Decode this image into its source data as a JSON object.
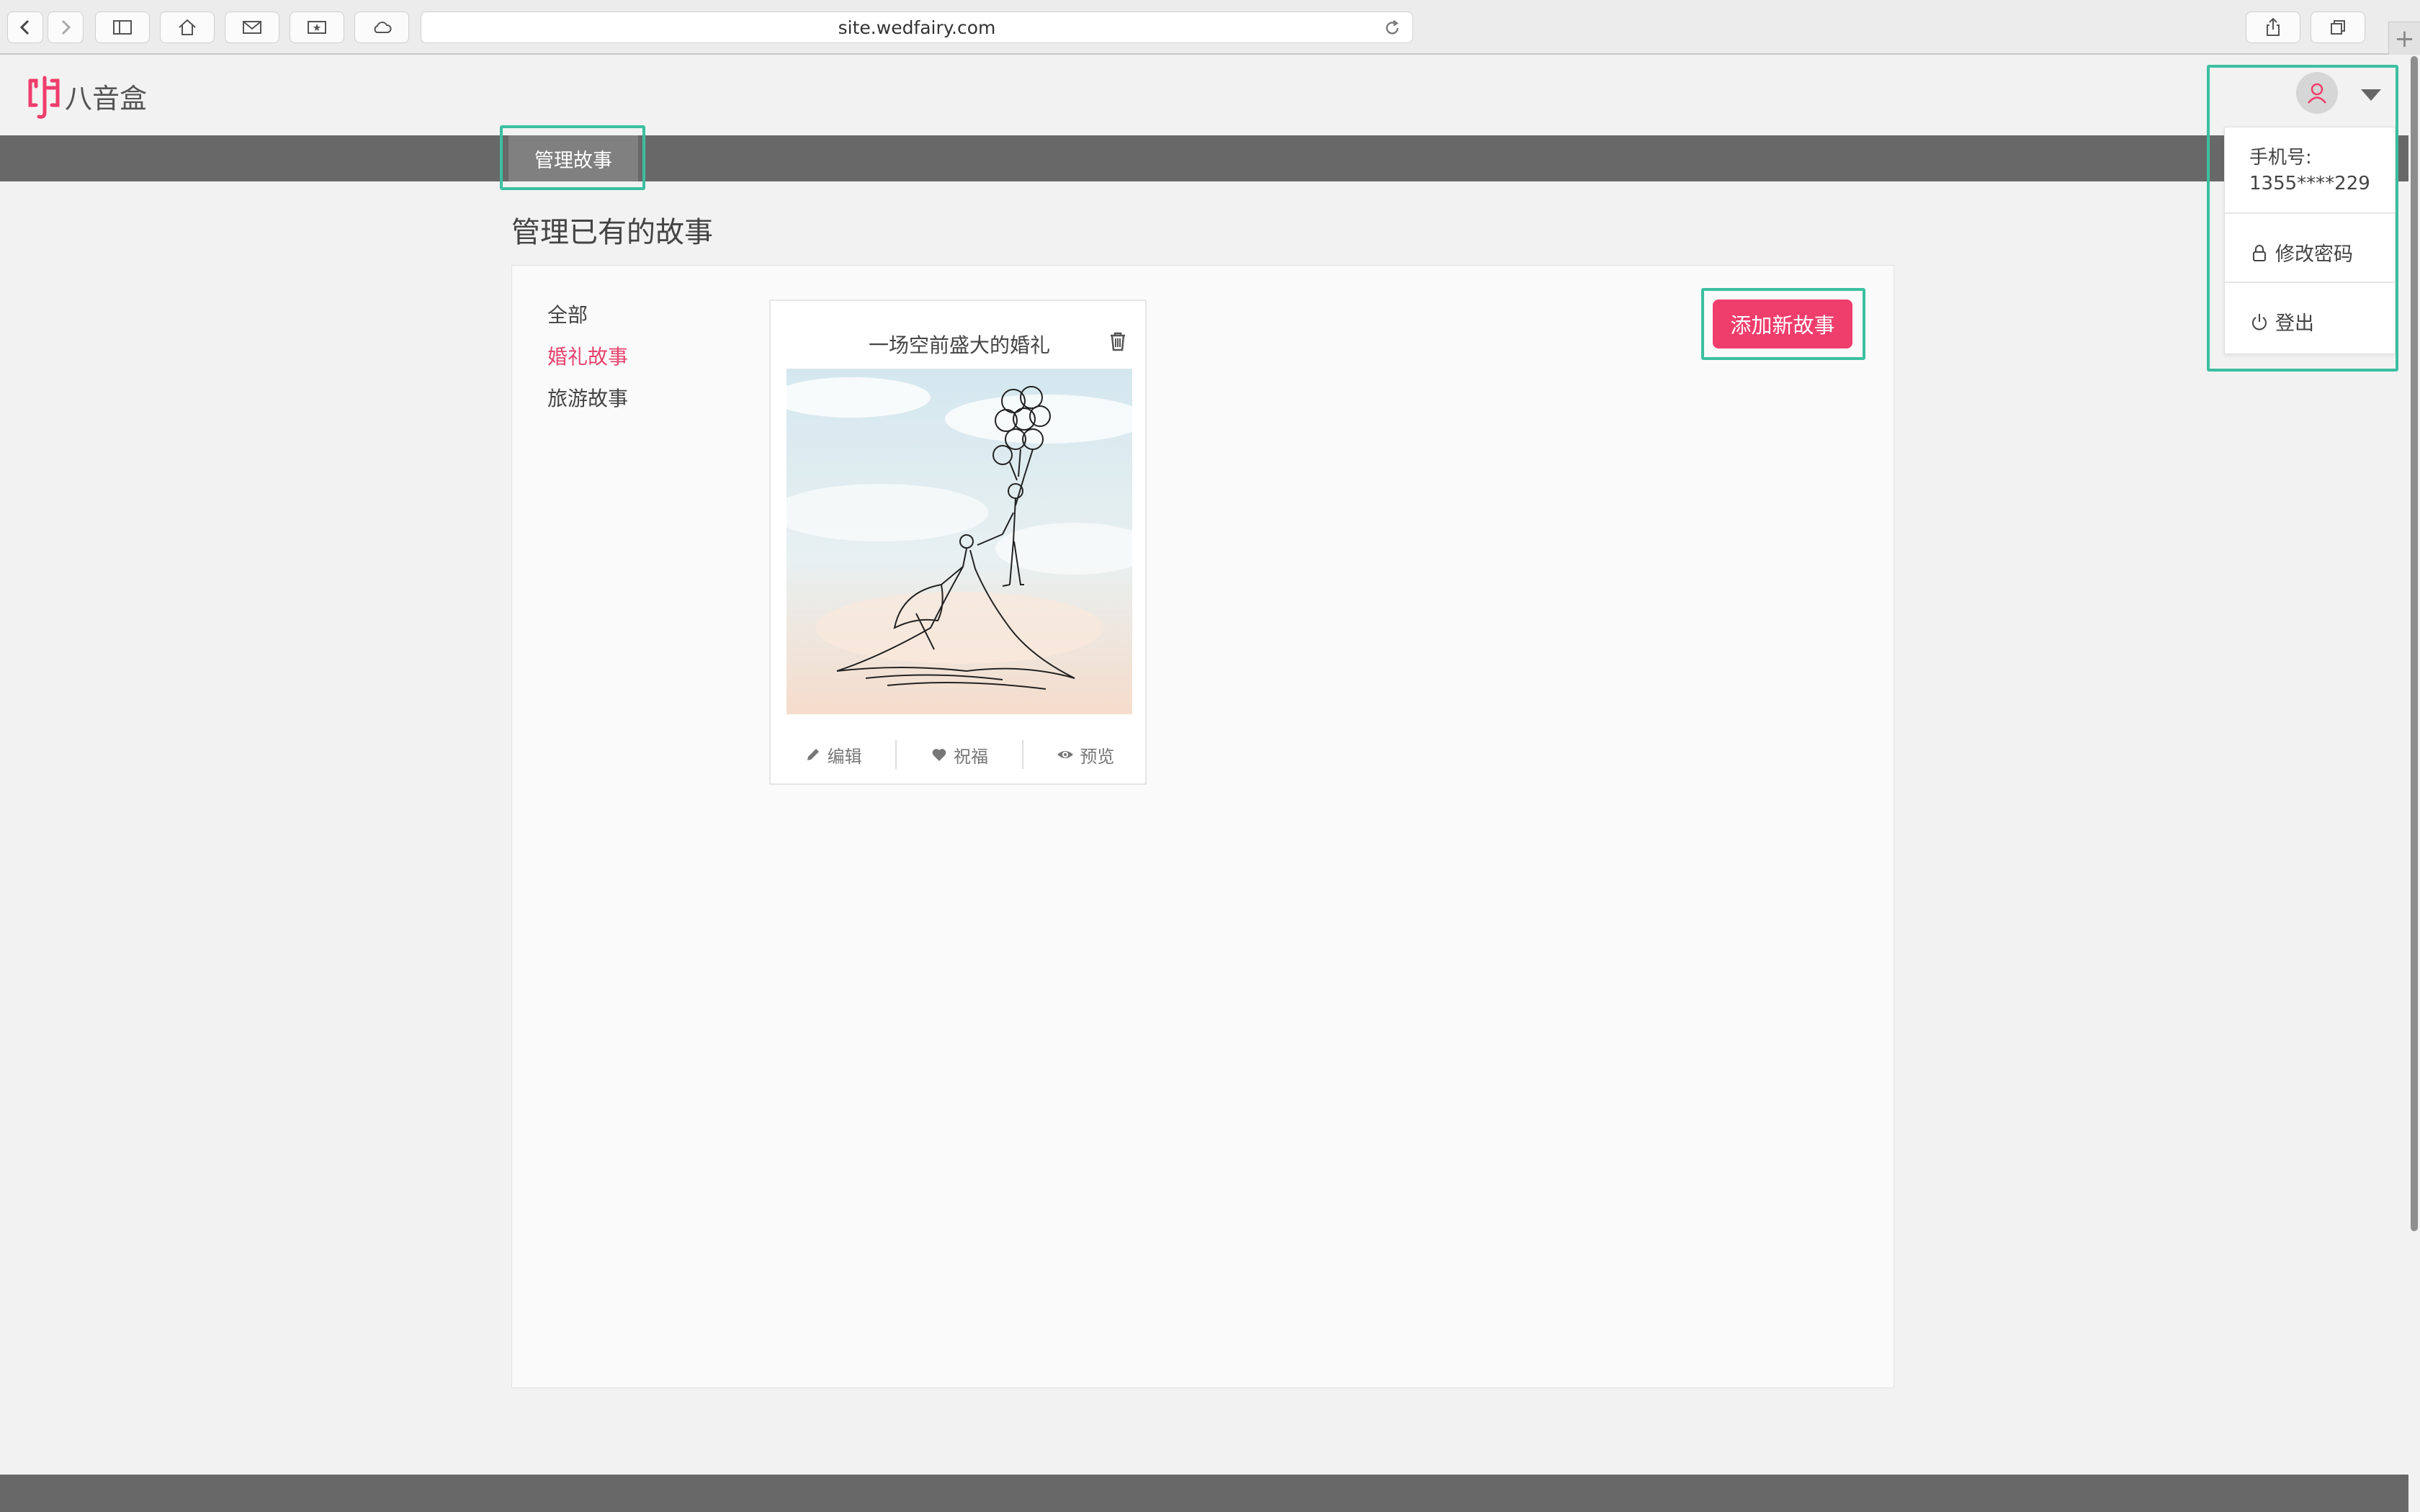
{
  "browser": {
    "url": "site.wedfairy.com"
  },
  "header": {
    "logo_text": "八音盒"
  },
  "nav": {
    "tab": "管理故事"
  },
  "main": {
    "title": "管理已有的故事",
    "categories": [
      "全部",
      "婚礼故事",
      "旅游故事"
    ],
    "active_category": "婚礼故事",
    "add_button": "添加新故事",
    "story": {
      "title": "一场空前盛大的婚礼",
      "actions": [
        "编辑",
        "祝福",
        "预览"
      ]
    }
  },
  "user_menu": {
    "phone_label": "手机号:",
    "phone_value": "1355****229",
    "items": [
      "修改密码",
      "登出"
    ]
  },
  "colors": {
    "accent": "#ef3d6c",
    "highlight": "#3cbfa0",
    "navbar": "#686868"
  }
}
